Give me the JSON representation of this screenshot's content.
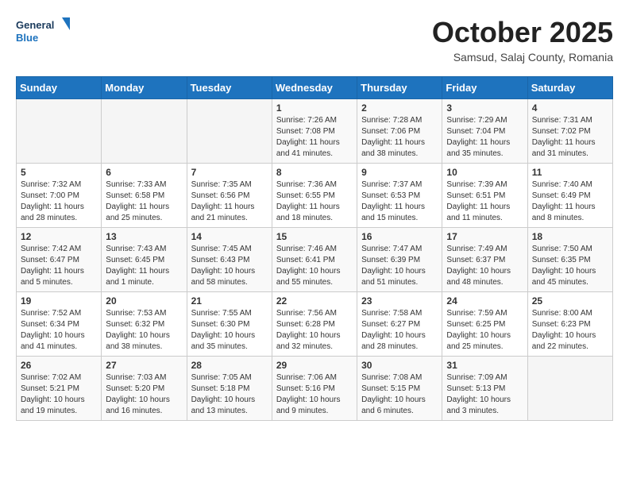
{
  "header": {
    "logo": {
      "line1": "General",
      "line2": "Blue"
    },
    "title": "October 2025",
    "subtitle": "Samsud, Salaj County, Romania"
  },
  "days_of_week": [
    "Sunday",
    "Monday",
    "Tuesday",
    "Wednesday",
    "Thursday",
    "Friday",
    "Saturday"
  ],
  "weeks": [
    [
      {
        "day": "",
        "info": ""
      },
      {
        "day": "",
        "info": ""
      },
      {
        "day": "",
        "info": ""
      },
      {
        "day": "1",
        "info": "Sunrise: 7:26 AM\nSunset: 7:08 PM\nDaylight: 11 hours\nand 41 minutes."
      },
      {
        "day": "2",
        "info": "Sunrise: 7:28 AM\nSunset: 7:06 PM\nDaylight: 11 hours\nand 38 minutes."
      },
      {
        "day": "3",
        "info": "Sunrise: 7:29 AM\nSunset: 7:04 PM\nDaylight: 11 hours\nand 35 minutes."
      },
      {
        "day": "4",
        "info": "Sunrise: 7:31 AM\nSunset: 7:02 PM\nDaylight: 11 hours\nand 31 minutes."
      }
    ],
    [
      {
        "day": "5",
        "info": "Sunrise: 7:32 AM\nSunset: 7:00 PM\nDaylight: 11 hours\nand 28 minutes."
      },
      {
        "day": "6",
        "info": "Sunrise: 7:33 AM\nSunset: 6:58 PM\nDaylight: 11 hours\nand 25 minutes."
      },
      {
        "day": "7",
        "info": "Sunrise: 7:35 AM\nSunset: 6:56 PM\nDaylight: 11 hours\nand 21 minutes."
      },
      {
        "day": "8",
        "info": "Sunrise: 7:36 AM\nSunset: 6:55 PM\nDaylight: 11 hours\nand 18 minutes."
      },
      {
        "day": "9",
        "info": "Sunrise: 7:37 AM\nSunset: 6:53 PM\nDaylight: 11 hours\nand 15 minutes."
      },
      {
        "day": "10",
        "info": "Sunrise: 7:39 AM\nSunset: 6:51 PM\nDaylight: 11 hours\nand 11 minutes."
      },
      {
        "day": "11",
        "info": "Sunrise: 7:40 AM\nSunset: 6:49 PM\nDaylight: 11 hours\nand 8 minutes."
      }
    ],
    [
      {
        "day": "12",
        "info": "Sunrise: 7:42 AM\nSunset: 6:47 PM\nDaylight: 11 hours\nand 5 minutes."
      },
      {
        "day": "13",
        "info": "Sunrise: 7:43 AM\nSunset: 6:45 PM\nDaylight: 11 hours\nand 1 minute."
      },
      {
        "day": "14",
        "info": "Sunrise: 7:45 AM\nSunset: 6:43 PM\nDaylight: 10 hours\nand 58 minutes."
      },
      {
        "day": "15",
        "info": "Sunrise: 7:46 AM\nSunset: 6:41 PM\nDaylight: 10 hours\nand 55 minutes."
      },
      {
        "day": "16",
        "info": "Sunrise: 7:47 AM\nSunset: 6:39 PM\nDaylight: 10 hours\nand 51 minutes."
      },
      {
        "day": "17",
        "info": "Sunrise: 7:49 AM\nSunset: 6:37 PM\nDaylight: 10 hours\nand 48 minutes."
      },
      {
        "day": "18",
        "info": "Sunrise: 7:50 AM\nSunset: 6:35 PM\nDaylight: 10 hours\nand 45 minutes."
      }
    ],
    [
      {
        "day": "19",
        "info": "Sunrise: 7:52 AM\nSunset: 6:34 PM\nDaylight: 10 hours\nand 41 minutes."
      },
      {
        "day": "20",
        "info": "Sunrise: 7:53 AM\nSunset: 6:32 PM\nDaylight: 10 hours\nand 38 minutes."
      },
      {
        "day": "21",
        "info": "Sunrise: 7:55 AM\nSunset: 6:30 PM\nDaylight: 10 hours\nand 35 minutes."
      },
      {
        "day": "22",
        "info": "Sunrise: 7:56 AM\nSunset: 6:28 PM\nDaylight: 10 hours\nand 32 minutes."
      },
      {
        "day": "23",
        "info": "Sunrise: 7:58 AM\nSunset: 6:27 PM\nDaylight: 10 hours\nand 28 minutes."
      },
      {
        "day": "24",
        "info": "Sunrise: 7:59 AM\nSunset: 6:25 PM\nDaylight: 10 hours\nand 25 minutes."
      },
      {
        "day": "25",
        "info": "Sunrise: 8:00 AM\nSunset: 6:23 PM\nDaylight: 10 hours\nand 22 minutes."
      }
    ],
    [
      {
        "day": "26",
        "info": "Sunrise: 7:02 AM\nSunset: 5:21 PM\nDaylight: 10 hours\nand 19 minutes."
      },
      {
        "day": "27",
        "info": "Sunrise: 7:03 AM\nSunset: 5:20 PM\nDaylight: 10 hours\nand 16 minutes."
      },
      {
        "day": "28",
        "info": "Sunrise: 7:05 AM\nSunset: 5:18 PM\nDaylight: 10 hours\nand 13 minutes."
      },
      {
        "day": "29",
        "info": "Sunrise: 7:06 AM\nSunset: 5:16 PM\nDaylight: 10 hours\nand 9 minutes."
      },
      {
        "day": "30",
        "info": "Sunrise: 7:08 AM\nSunset: 5:15 PM\nDaylight: 10 hours\nand 6 minutes."
      },
      {
        "day": "31",
        "info": "Sunrise: 7:09 AM\nSunset: 5:13 PM\nDaylight: 10 hours\nand 3 minutes."
      },
      {
        "day": "",
        "info": ""
      }
    ]
  ]
}
